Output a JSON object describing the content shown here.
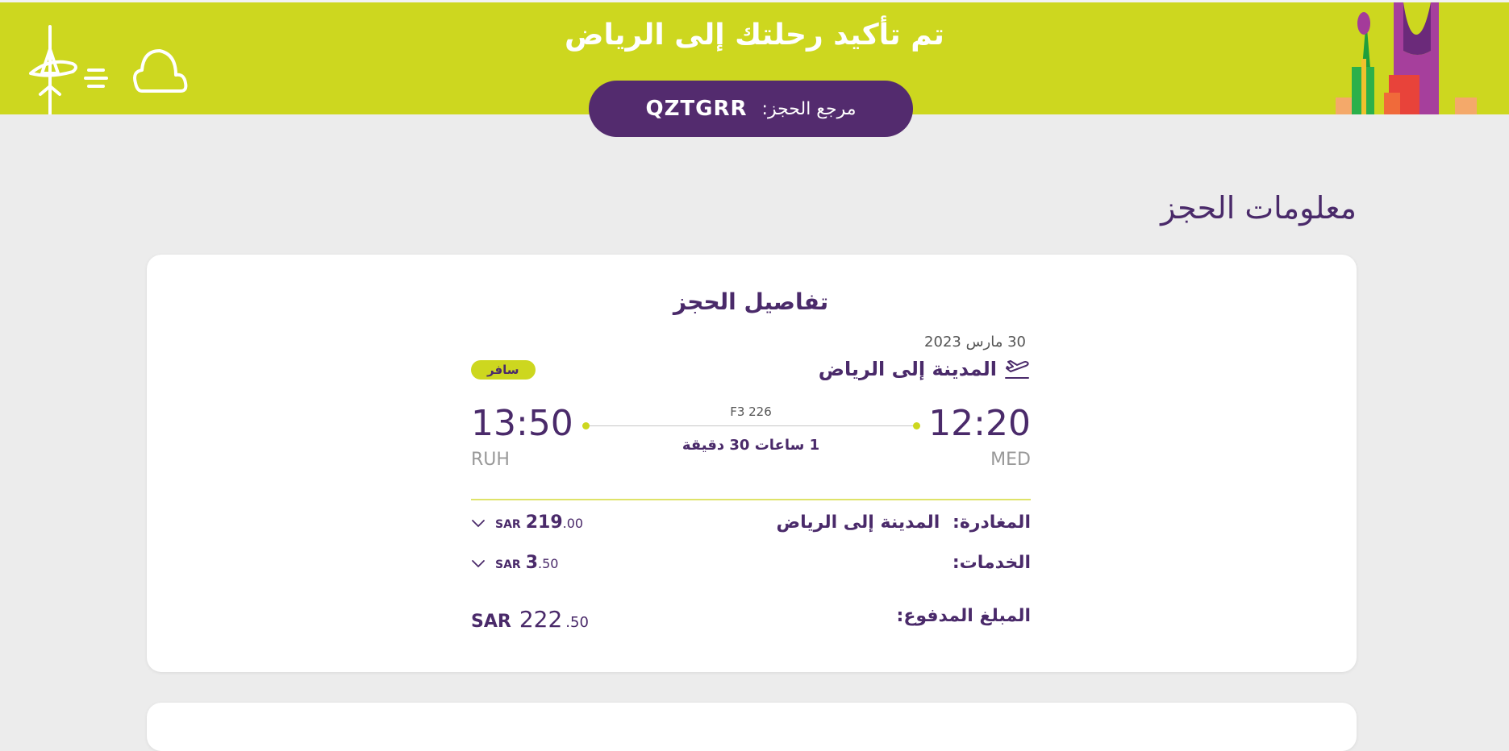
{
  "banner": {
    "title": "تم تأكيد رحلتك إلى الرياض",
    "booking_ref_label": "مرجع الحجز:",
    "booking_ref_value": "QZTGRR"
  },
  "section": {
    "title": "معلومات الحجز"
  },
  "booking": {
    "title": "تفاصيل الحجز",
    "date": "30 مارس 2023",
    "route": "المدينة إلى الرياض",
    "status": "سافر",
    "departure_time": "12:20",
    "departure_code": "MED",
    "arrival_time": "13:50",
    "arrival_code": "RUH",
    "flight_number": "F3 226",
    "duration": "1 ساعات 30 دقيقة"
  },
  "charges": {
    "departure": {
      "label": "المغادرة:",
      "route": "المدينة إلى  الرياض",
      "currency": "SAR",
      "amount_int": "219",
      "amount_dec": ".00"
    },
    "services": {
      "label": "الخدمات:",
      "currency": "SAR",
      "amount_int": "3",
      "amount_dec": ".50"
    },
    "total": {
      "label": "المبلغ المدفوع:",
      "currency": "SAR",
      "amount_int": "222",
      "amount_dec": ".50"
    }
  },
  "colors": {
    "brand_lime": "#cdd71f",
    "brand_purple": "#532b6e",
    "background": "#ececec"
  },
  "icons": [
    "airplane-illustration",
    "cloud-illustration",
    "riyadh-skyline-illustration",
    "plane-takeoff-icon",
    "chevron-down-icon"
  ]
}
